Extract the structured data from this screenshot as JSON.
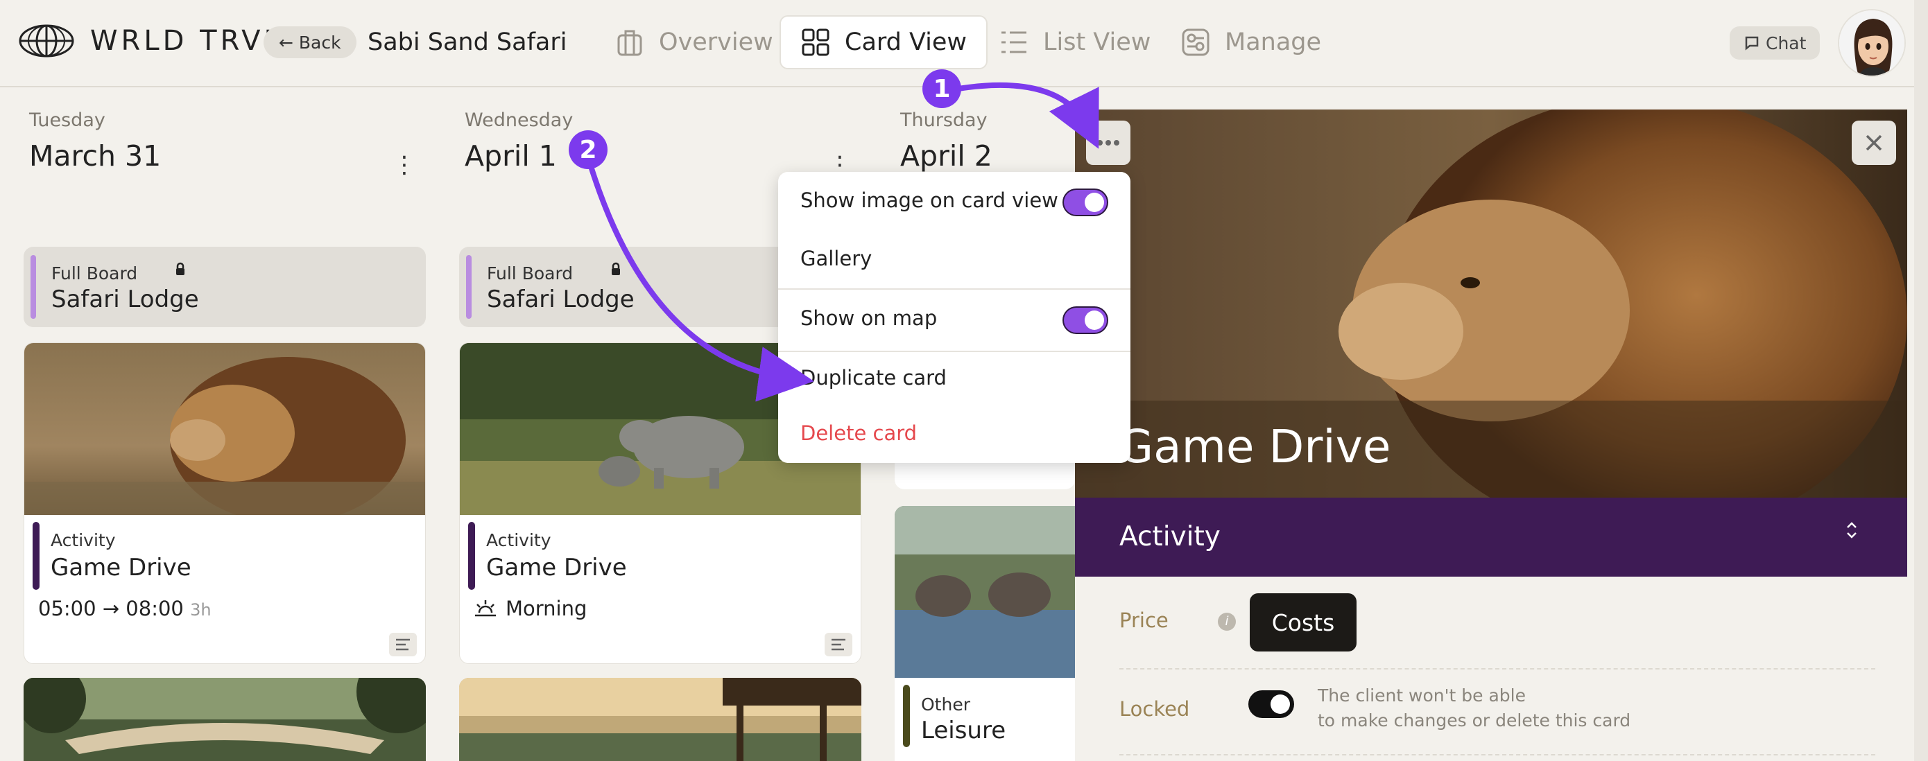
{
  "app": {
    "logo_text": "WRLD TRVL",
    "back_label": "Back",
    "trip_title": "Sabi Sand Safari"
  },
  "tabs": [
    {
      "label": "Overview",
      "active": false
    },
    {
      "label": "Card View",
      "active": true
    },
    {
      "label": "List View",
      "active": false
    },
    {
      "label": "Manage",
      "active": false
    }
  ],
  "chat_label": "Chat",
  "days": [
    {
      "weekday": "Tuesday",
      "date": "March 31",
      "hotel": {
        "category": "Full Board",
        "name": "Safari Lodge"
      },
      "activity": {
        "category": "Activity",
        "name": "Game Drive",
        "time": "05:00 → 08:00",
        "duration": "3h"
      }
    },
    {
      "weekday": "Wednesday",
      "date": "April 1",
      "hotel": {
        "category": "Full Board",
        "name": "Safari Lodge"
      },
      "activity": {
        "category": "Activity",
        "name": "Game Drive",
        "time_of_day": "Morning"
      }
    },
    {
      "weekday": "Thursday",
      "date": "April 2",
      "other_card": {
        "category": "Other",
        "name": "Leisure"
      }
    }
  ],
  "context_menu": {
    "items": [
      {
        "label": "Show image on card view",
        "toggle": true
      },
      {
        "label": "Gallery"
      },
      {
        "label": "Show on map",
        "toggle": true
      },
      {
        "label": "Duplicate card"
      },
      {
        "label": "Delete card",
        "color": "#e5484d"
      }
    ]
  },
  "detail_panel": {
    "title": "Game Drive",
    "category": "Activity",
    "category_color": "#3e1b55",
    "price_label": "Price",
    "costs_label": "Costs",
    "locked_label": "Locked",
    "locked_on": true,
    "lock_desc_line1": "The client won't be able",
    "lock_desc_line2": "to make changes or delete this card"
  },
  "annotations": {
    "badge1": "1",
    "badge2": "2",
    "color": "#7c3aed"
  },
  "colors": {
    "accent": "#8f4fe4",
    "hotel_bar": "#b98de0",
    "activity_bar": "#3e1b55",
    "other_bar": "#4a4a1c"
  }
}
